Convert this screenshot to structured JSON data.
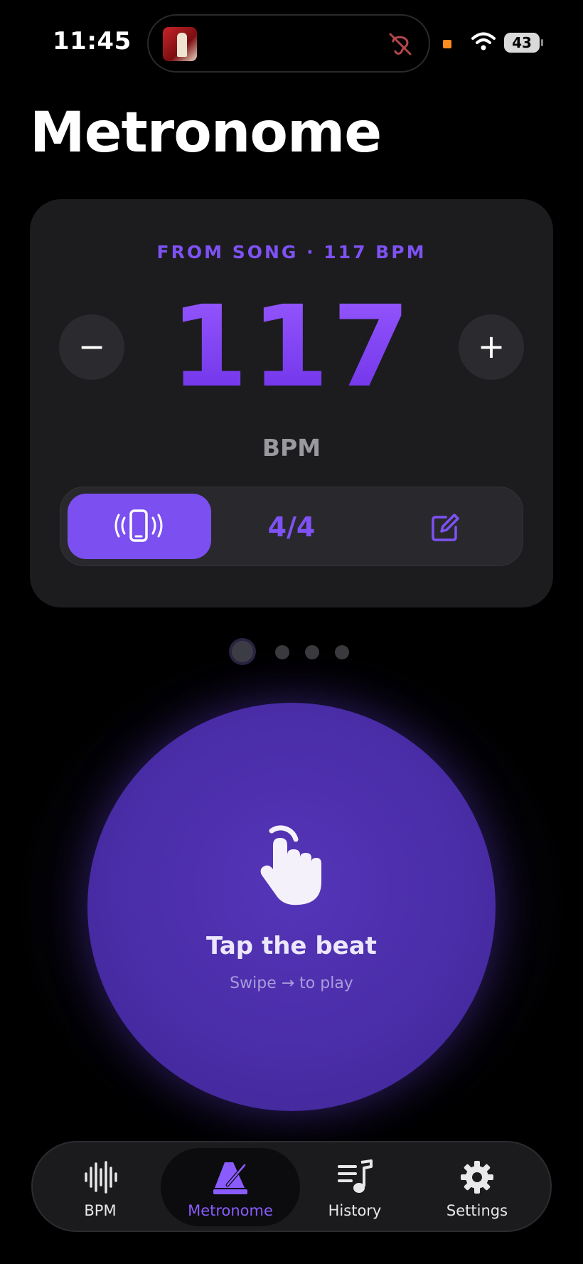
{
  "status_bar": {
    "time": "11:45",
    "battery": "43"
  },
  "app": {
    "title": "Metronome"
  },
  "bpm_card": {
    "source_label": "FROM SONG · 117 BPM",
    "bpm_value": "117",
    "unit": "BPM",
    "minus_label": "−",
    "plus_label": "+",
    "time_signature": "4/4"
  },
  "pager": {
    "pages": 4,
    "current": 1
  },
  "tap_area": {
    "title": "Tap the beat",
    "subtitle": "Swipe → to play"
  },
  "tab_bar": {
    "items": [
      {
        "label": "BPM",
        "icon": "waveform-icon"
      },
      {
        "label": "Metronome",
        "icon": "metronome-icon",
        "selected": true
      },
      {
        "label": "History",
        "icon": "music-list-icon"
      },
      {
        "label": "Settings",
        "icon": "gear-icon"
      }
    ]
  },
  "colors": {
    "accent": "#7b4ff0",
    "background": "#000000",
    "card": "#1c1c1f"
  }
}
